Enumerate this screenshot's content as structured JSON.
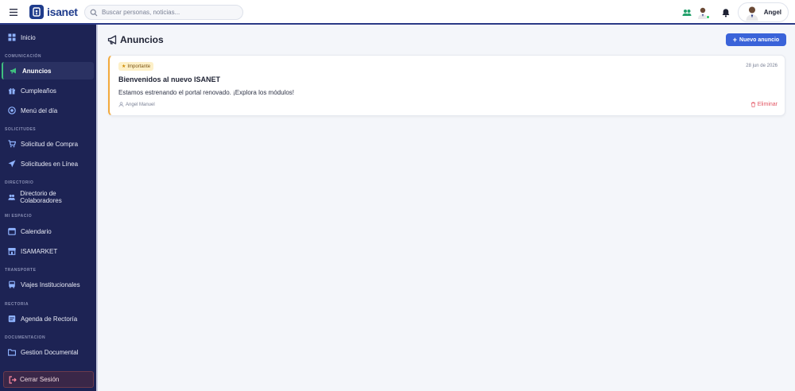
{
  "header": {
    "brand": "isanet",
    "search_placeholder": "Buscar personas, noticias...",
    "user_name": "Angel"
  },
  "sidebar": {
    "home": "Inicio",
    "sections": {
      "comunicacion": "COMUNICACIÓN",
      "solicitudes": "SOLICITUDES",
      "directorio": "DIRECTORIO",
      "mi_espacio": "MI ESPACIO",
      "transporte": "TRANSPORTE",
      "rectoria": "RECTORIA",
      "documentacion": "DOCUMENTACION"
    },
    "items": {
      "anuncios": "Anuncios",
      "cumpleanos": "Cumpleaños",
      "menu": "Menú del día",
      "compra": "Solicitud de Compra",
      "solicitudes_linea": "Solicitudes en Línea",
      "directorio": "Directorio de Colaboradores",
      "calendario": "Calendario",
      "isamarket": "ISAMARKET",
      "viajes": "Viajes Institucionales",
      "agenda": "Agenda de Rectoría",
      "gestion": "Gestion Documental"
    },
    "logout": "Cerrar Sesión"
  },
  "main": {
    "title": "Anuncios",
    "new_button": "Nuevo anuncio",
    "announcements": [
      {
        "badge": "Importante",
        "date": "28 jun de 2026",
        "title": "Bienvenidos al nuevo ISANET",
        "body": "Estamos estrenando el portal renovado. ¡Explora los módulos!",
        "author": "Angel Manuel",
        "delete_label": "Eliminar"
      }
    ]
  },
  "colors": {
    "sidebar_bg": "#1d2354",
    "primary": "#3a63d9",
    "accent_green": "#3fbf7f",
    "badge_bg": "#fdf0c8",
    "danger": "#e25563",
    "card_border_accent": "#f2a93b"
  },
  "icons": {
    "menu": "hamburger-icon",
    "search": "search-icon",
    "people": "people-icon",
    "bell": "bell-icon",
    "megaphone": "megaphone-icon",
    "star": "star-icon",
    "user": "user-icon",
    "trash": "trash-icon",
    "logout": "logout-icon"
  }
}
